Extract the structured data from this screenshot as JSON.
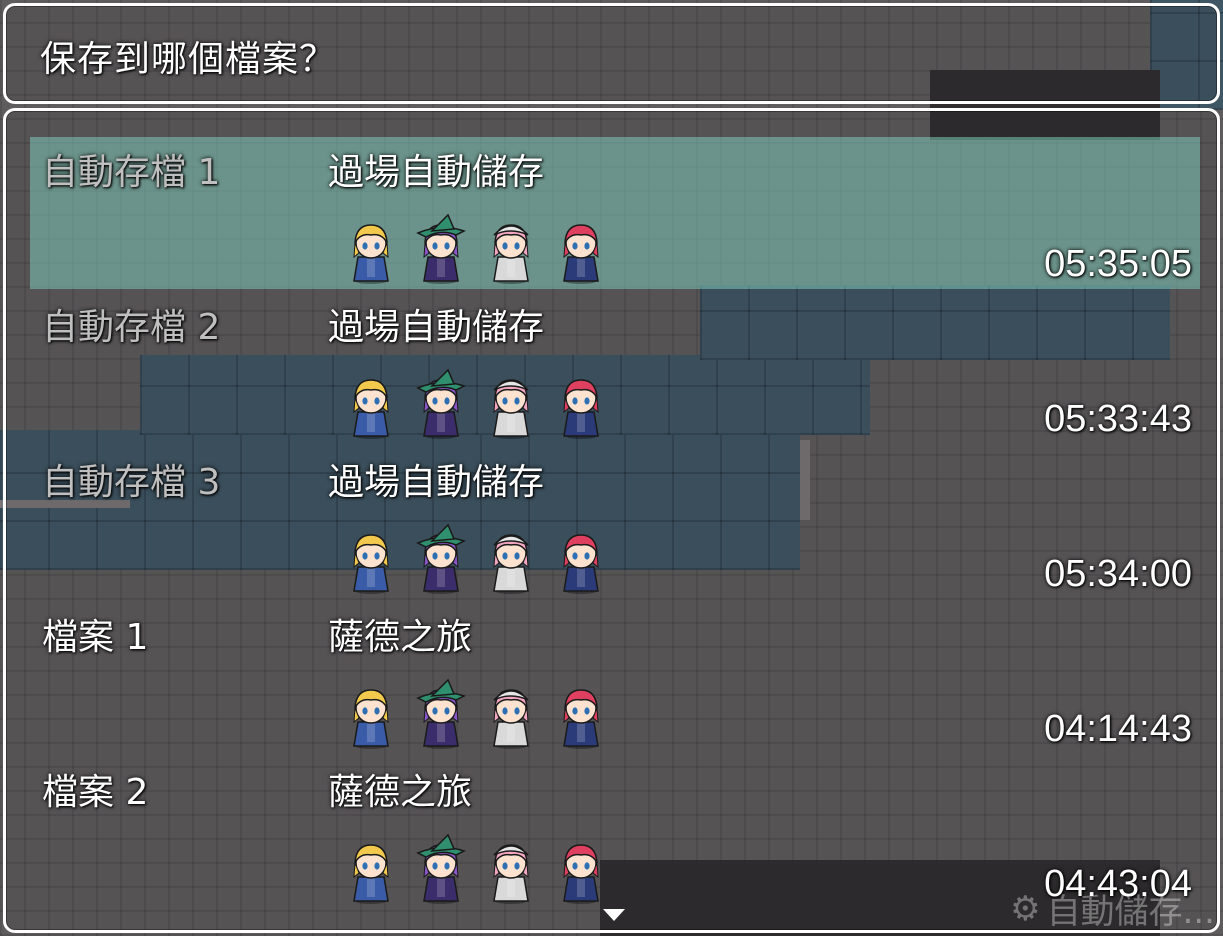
{
  "help": {
    "text": "保存到哪個檔案？"
  },
  "slots": [
    {
      "label": "自動存檔 1",
      "title": "過場自動儲存",
      "playtime": "05:35:05",
      "dim": true,
      "selected": true
    },
    {
      "label": "自動存檔 2",
      "title": "過場自動儲存",
      "playtime": "05:33:43",
      "dim": true,
      "selected": false
    },
    {
      "label": "自動存檔 3",
      "title": "過場自動儲存",
      "playtime": "05:34:00",
      "dim": true,
      "selected": false
    },
    {
      "label": "檔案 1",
      "title": "薩德之旅",
      "playtime": "04:14:43",
      "dim": false,
      "selected": false
    },
    {
      "label": "檔案 2",
      "title": "薩德之旅",
      "playtime": "04:43:04",
      "dim": false,
      "selected": false
    }
  ],
  "party": [
    {
      "name": "blonde-blue-mage",
      "hair": "#f2c94c",
      "outfit": "#3a5ba8",
      "hat": null
    },
    {
      "name": "witch-green-hat",
      "hair": "#8a56c9",
      "outfit": "#3b2d6b",
      "hat": "#2f8f6e"
    },
    {
      "name": "pink-hair-priestess",
      "hair": "#f3a6c0",
      "outfit": "#d9d9d9",
      "hat": "#e6e6e6"
    },
    {
      "name": "red-hair-fighter",
      "hair": "#e0405f",
      "outfit": "#2b3b7a",
      "hat": null
    }
  ],
  "autosave_indicator": "自動儲存..."
}
